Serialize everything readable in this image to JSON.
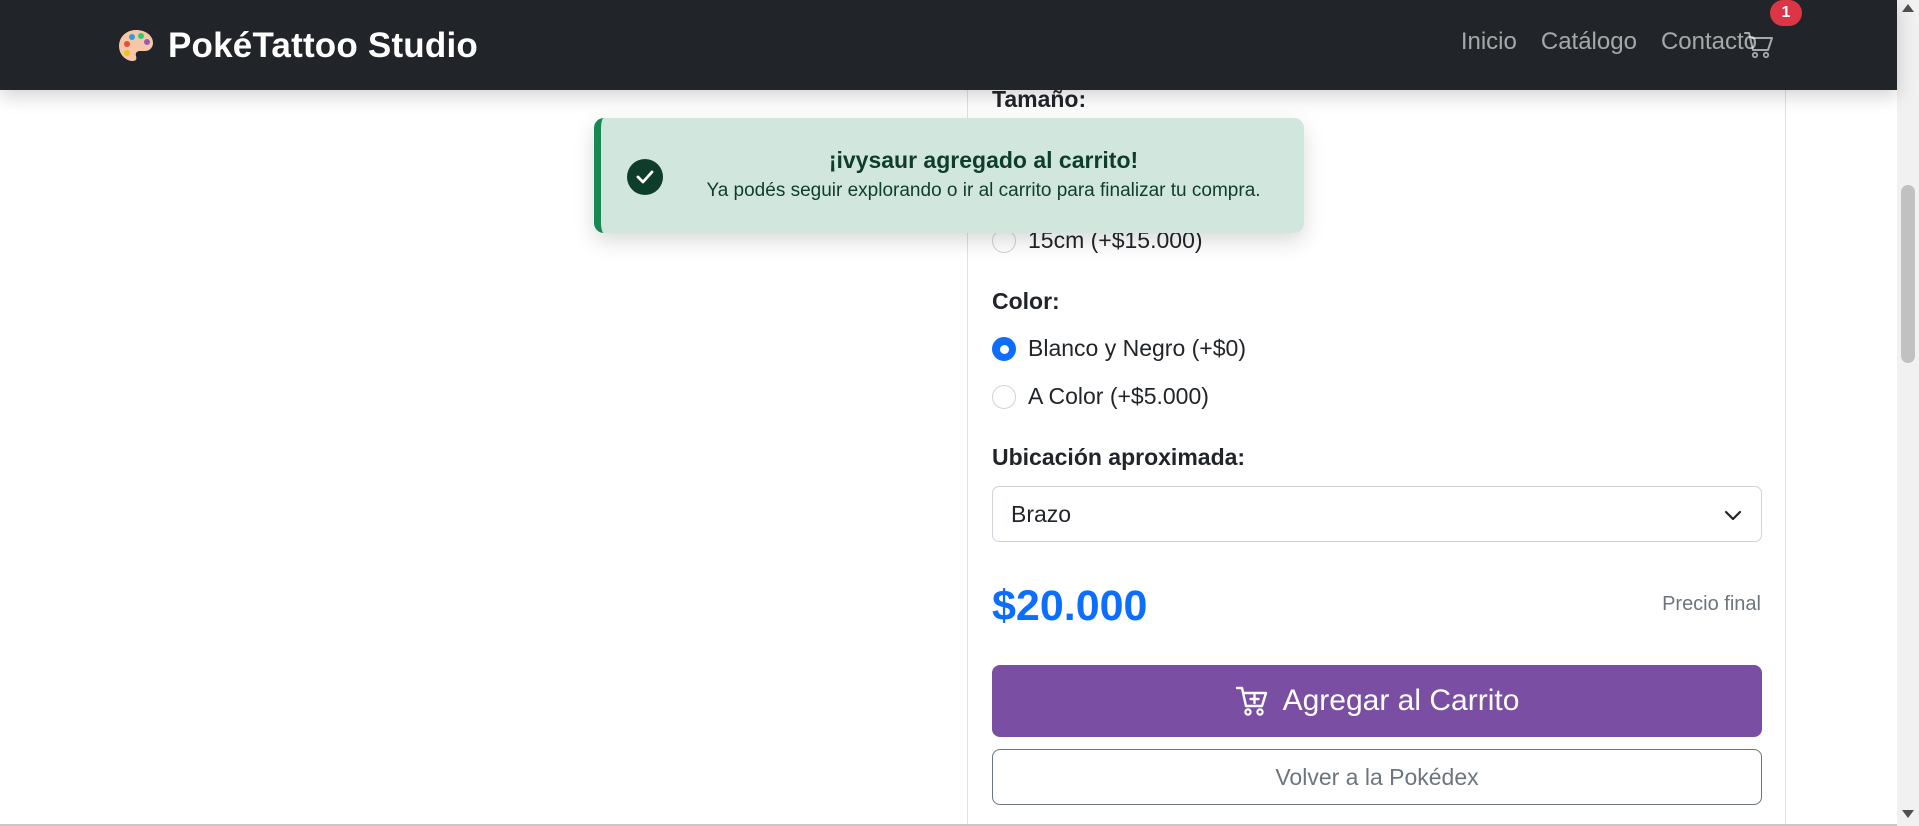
{
  "navbar": {
    "brand_icon": "palette-icon",
    "brand_name": "PokéTattoo Studio",
    "links": [
      "Inicio",
      "Catálogo",
      "Contacto"
    ],
    "cart_icon": "cart-icon",
    "cart_count": "1"
  },
  "toast": {
    "icon": "check-circle-icon",
    "title": "¡ivysaur agregado al carrito!",
    "message": "Ya podés seguir explorando o ir al carrito para finalizar tu compra.",
    "color": "#198754"
  },
  "options": {
    "size_label": "Tamaño:",
    "size_options": [
      {
        "label": "15cm (+$15.000)",
        "checked": false
      }
    ],
    "color_label": "Color:",
    "color_options": [
      {
        "label": "Blanco y Negro (+$0)",
        "checked": true
      },
      {
        "label": "A Color (+$5.000)",
        "checked": false
      }
    ],
    "location_label": "Ubicación aproximada:",
    "location_value": "Brazo"
  },
  "summary": {
    "price": "$20.000",
    "price_note": "Precio final"
  },
  "actions": {
    "add_to_cart": "Agregar al Carrito",
    "add_icon": "cart-plus-icon",
    "back": "Volver a la Pokédex"
  },
  "colors": {
    "navbar": "#212529",
    "accent": "#0d6efd",
    "primary_button": "#7a4ea3",
    "badge": "#dc3545"
  }
}
